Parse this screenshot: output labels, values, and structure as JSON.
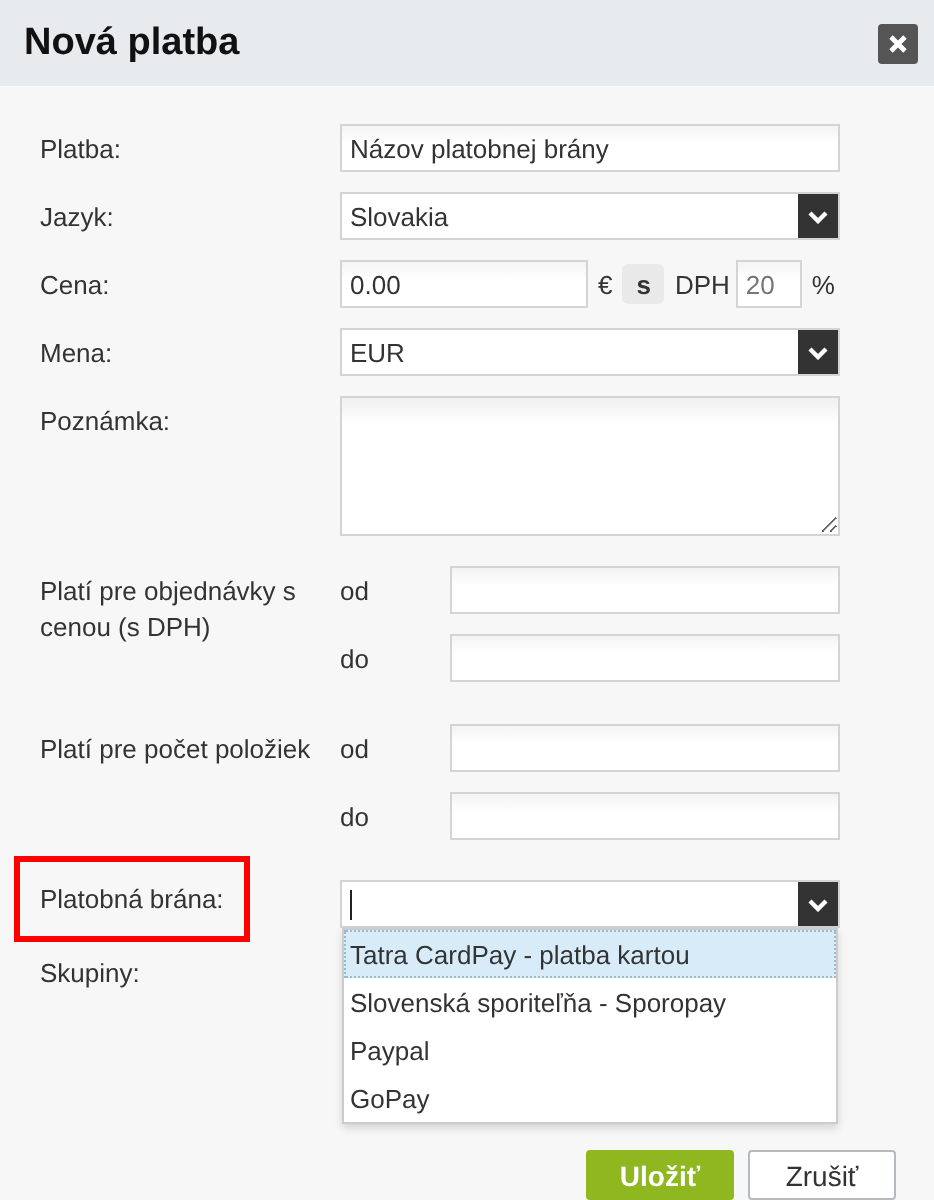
{
  "window": {
    "title": "Nová platba"
  },
  "fields": [
    {
      "kind": "text",
      "label": "Platba:",
      "value": "Názov platobnej brány"
    },
    {
      "kind": "select",
      "label": "Jazyk:",
      "value": "Slovakia"
    },
    {
      "kind": "price",
      "label": "Cena:",
      "value": "0.00",
      "currency": "€",
      "toggle": "s",
      "vat_label": "DPH",
      "vat_placeholder": "20",
      "percent": "%"
    },
    {
      "kind": "select",
      "label": "Mena:",
      "value": "EUR"
    },
    {
      "kind": "textarea",
      "label": "Poznámka:"
    },
    {
      "kind": "range",
      "label": "Platí pre objednávky s cenou (s DPH)",
      "from_label": "od",
      "to_label": "do"
    },
    {
      "kind": "range",
      "label": "Platí pre počet položiek",
      "from_label": "od",
      "to_label": "do"
    },
    {
      "kind": "combo",
      "label": "Platobná brána:",
      "highlighted": true,
      "expanded": true,
      "options": [
        {
          "label": "Tatra CardPay - platba kartou",
          "selected": true
        },
        {
          "label": "Slovenská sporiteľňa - Sporopay",
          "selected": false
        },
        {
          "label": "Paypal",
          "selected": false
        },
        {
          "label": "GoPay",
          "selected": false
        }
      ]
    },
    {
      "kind": "plain",
      "label": "Skupiny:"
    }
  ],
  "buttons": [
    {
      "label": "Uložiť",
      "kind": "primary"
    },
    {
      "label": "Zrušiť",
      "kind": "secondary"
    }
  ]
}
